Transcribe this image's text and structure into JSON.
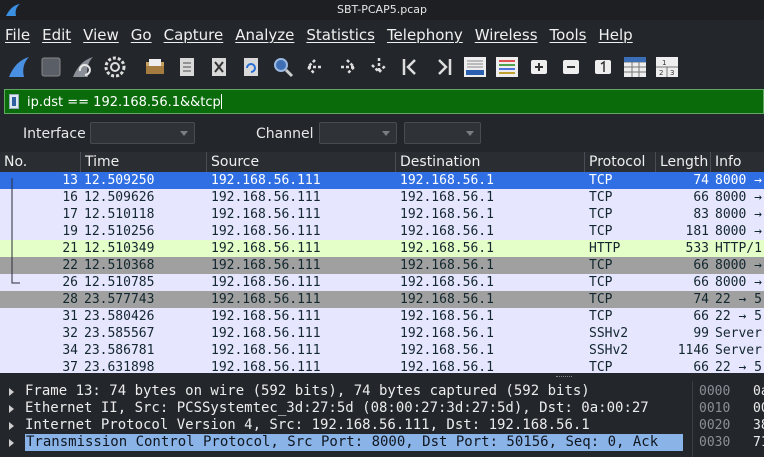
{
  "window": {
    "title": "SBT-PCAP5.pcap"
  },
  "menu": [
    "File",
    "Edit",
    "View",
    "Go",
    "Capture",
    "Analyze",
    "Statistics",
    "Telephony",
    "Wireless",
    "Tools",
    "Help"
  ],
  "toolbar": {
    "icons": [
      "start-capture-icon",
      "stop-capture-icon",
      "restart-capture-icon",
      "capture-options-icon",
      "open-file-icon",
      "save-file-icon",
      "close-file-icon",
      "reload-file-icon",
      "find-packet-icon",
      "go-back-icon",
      "go-forward-icon",
      "go-to-packet-icon",
      "go-first-icon",
      "go-last-icon",
      "autoscroll-icon",
      "colorize-icon",
      "zoom-in-icon",
      "zoom-out-icon",
      "normal-size-icon",
      "resize-columns-icon",
      "expand-icon"
    ]
  },
  "filter": {
    "value": "ip.dst == 192.168.56.1&&tcp"
  },
  "iface": {
    "interface_label": "Interface",
    "channel_label": "Channel"
  },
  "columns": [
    "No.",
    "Time",
    "Source",
    "Destination",
    "Protocol",
    "Length",
    "Info"
  ],
  "packets": [
    {
      "no": "13",
      "time": "12.509250",
      "src": "192.168.56.111",
      "dst": "192.168.56.1",
      "proto": "TCP",
      "len": "74",
      "info": "8000 →",
      "style": "sel"
    },
    {
      "no": "16",
      "time": "12.509626",
      "src": "192.168.56.111",
      "dst": "192.168.56.1",
      "proto": "TCP",
      "len": "66",
      "info": "8000 →",
      "style": "tcp"
    },
    {
      "no": "17",
      "time": "12.510118",
      "src": "192.168.56.111",
      "dst": "192.168.56.1",
      "proto": "TCP",
      "len": "83",
      "info": "8000 →",
      "style": "tcp"
    },
    {
      "no": "19",
      "time": "12.510256",
      "src": "192.168.56.111",
      "dst": "192.168.56.1",
      "proto": "TCP",
      "len": "181",
      "info": "8000 →",
      "style": "tcp"
    },
    {
      "no": "21",
      "time": "12.510349",
      "src": "192.168.56.111",
      "dst": "192.168.56.1",
      "proto": "HTTP",
      "len": "533",
      "info": "HTTP/1",
      "style": "http"
    },
    {
      "no": "22",
      "time": "12.510368",
      "src": "192.168.56.111",
      "dst": "192.168.56.1",
      "proto": "TCP",
      "len": "66",
      "info": "8000 →",
      "style": "gray"
    },
    {
      "no": "26",
      "time": "12.510785",
      "src": "192.168.56.111",
      "dst": "192.168.56.1",
      "proto": "TCP",
      "len": "66",
      "info": "8000 →",
      "style": "tcp"
    },
    {
      "no": "28",
      "time": "23.577743",
      "src": "192.168.56.111",
      "dst": "192.168.56.1",
      "proto": "TCP",
      "len": "74",
      "info": "22 → 5",
      "style": "gray"
    },
    {
      "no": "31",
      "time": "23.580426",
      "src": "192.168.56.111",
      "dst": "192.168.56.1",
      "proto": "TCP",
      "len": "66",
      "info": "22 → 5",
      "style": "tcp"
    },
    {
      "no": "32",
      "time": "23.585567",
      "src": "192.168.56.111",
      "dst": "192.168.56.1",
      "proto": "SSHv2",
      "len": "99",
      "info": "Server",
      "style": "tcp"
    },
    {
      "no": "34",
      "time": "23.586781",
      "src": "192.168.56.111",
      "dst": "192.168.56.1",
      "proto": "SSHv2",
      "len": "1146",
      "info": "Server",
      "style": "tcp"
    },
    {
      "no": "37",
      "time": "23.631898",
      "src": "192.168.56.111",
      "dst": "192.168.56.1",
      "proto": "TCP",
      "len": "66",
      "info": "22 → 5",
      "style": "tcp"
    }
  ],
  "details": [
    {
      "text": "Frame 13: 74 bytes on wire (592 bits), 74 bytes captured (592 bits)",
      "selected": false
    },
    {
      "text": "Ethernet II, Src: PCSSystemtec_3d:27:5d (08:00:27:3d:27:5d), Dst: 0a:00:27",
      "selected": false
    },
    {
      "text": "Internet Protocol Version 4, Src: 192.168.56.111, Dst: 192.168.56.1",
      "selected": false
    },
    {
      "text": "Transmission Control Protocol, Src Port: 8000, Dst Port: 50156, Seq: 0, Ack",
      "selected": true
    }
  ],
  "bytes": [
    {
      "offset": "0000",
      "hex": "0a"
    },
    {
      "offset": "0010",
      "hex": "00"
    },
    {
      "offset": "0020",
      "hex": "38"
    },
    {
      "offset": "0030",
      "hex": "71"
    }
  ]
}
